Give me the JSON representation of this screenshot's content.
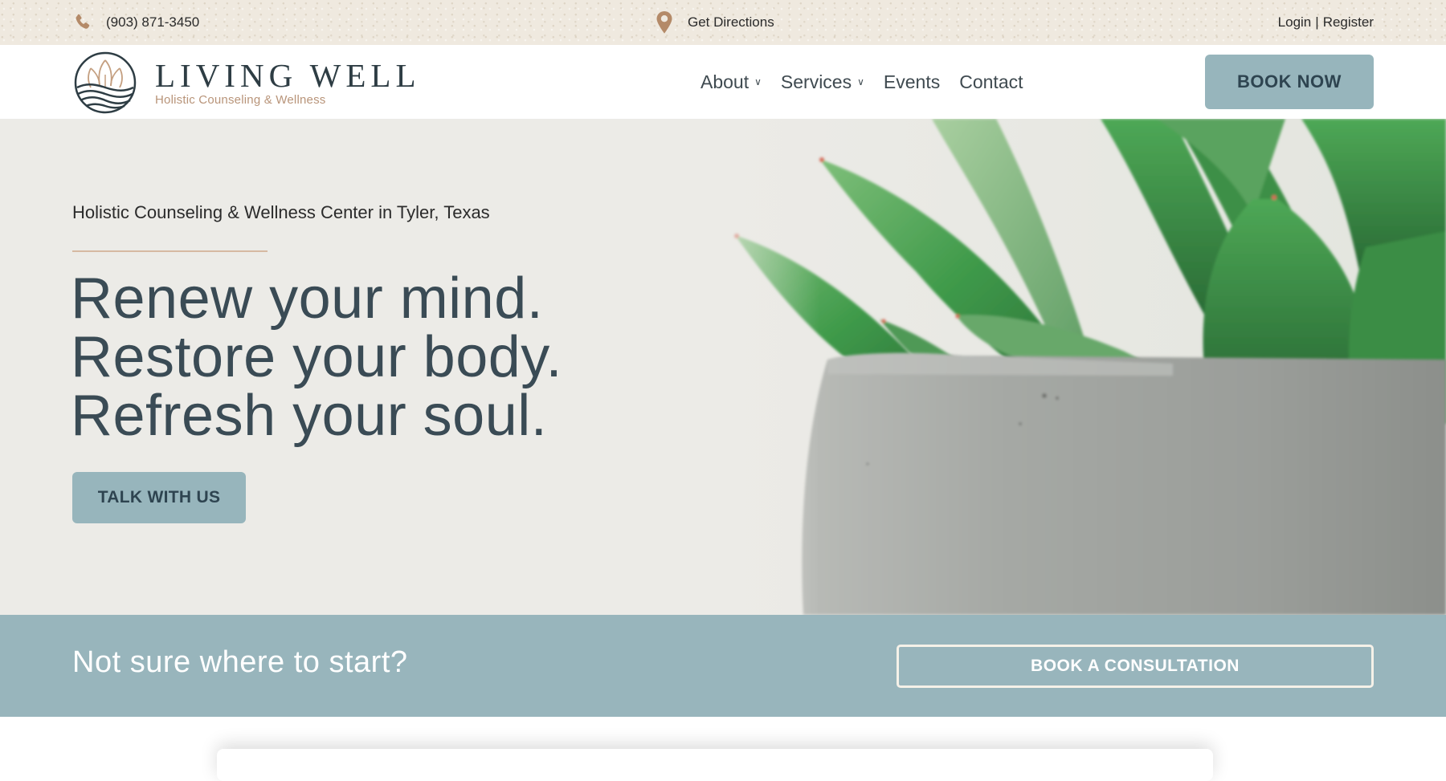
{
  "topbar": {
    "phone": {
      "icon": "phone-icon",
      "text": "(903) 871-3450"
    },
    "directions": {
      "icon": "map-pin-icon",
      "text": "Get Directions"
    },
    "login": "Login",
    "separator": "|",
    "register": "Register"
  },
  "header": {
    "logo": {
      "icon": "lotus-waves-logo-icon",
      "title": "LIVING WELL",
      "subtitle": "Holistic Counseling & Wellness"
    },
    "nav": [
      {
        "label": "About",
        "has_dropdown": true,
        "chevron": "⌄"
      },
      {
        "label": "Services",
        "has_dropdown": true,
        "chevron": "⌄"
      },
      {
        "label": "Events",
        "has_dropdown": false
      },
      {
        "label": "Contact",
        "has_dropdown": false
      }
    ],
    "book_now": "BOOK NOW"
  },
  "hero": {
    "tagline": "Holistic Counseling & Wellness Center in Tyler, Texas",
    "headline": [
      "Renew your mind.",
      "Restore your body.",
      "Refresh your soul."
    ],
    "cta": "TALK WITH US",
    "image": "succulent-in-concrete-pot"
  },
  "cta_band": {
    "text": "Not sure where to start?",
    "button": "BOOK A CONSULTATION"
  },
  "colors": {
    "accent_blue": "#97b5bc",
    "dark_slate": "#3a4b55",
    "accent_tan": "#b89479",
    "topbar_bg": "#efe9df",
    "hero_bg": "#ecebe7"
  }
}
